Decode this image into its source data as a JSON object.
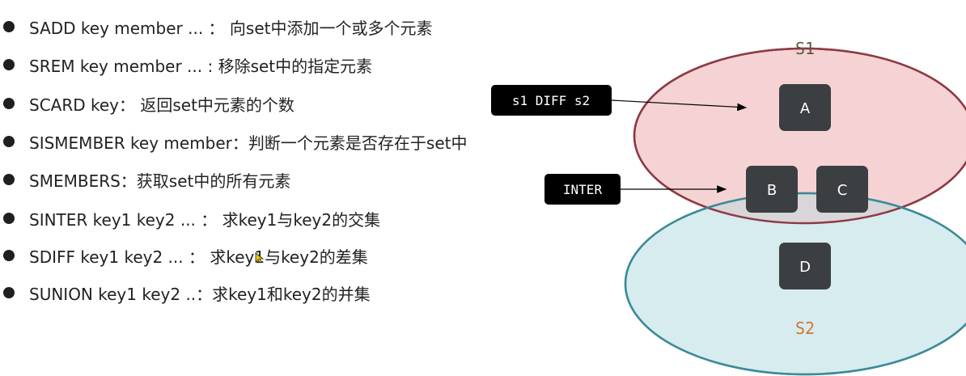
{
  "commands": [
    {
      "text": "SADD key member ... ： 向set中添加一个或多个元素"
    },
    {
      "text": "SREM key member ... : 移除set中的指定元素"
    },
    {
      "text": "SCARD key： 返回set中元素的个数"
    },
    {
      "text": "SISMEMBER key member：判断一个元素是否存在于set中"
    },
    {
      "text": "SMEMBERS：获取set中的所有元素"
    },
    {
      "text": "SINTER key1 key2 ... ： 求key1与key2的交集"
    },
    {
      "text": "SDIFF key1 key2 ... ： 求key1与key2的差集"
    },
    {
      "text": "SUNION key1 key2 ..：求key1和key2的并集"
    }
  ],
  "diagram": {
    "set1": {
      "label": "S1",
      "color": "#5a5a3a",
      "fill": "#f5d3d4",
      "stroke": "#8e3a44"
    },
    "set2": {
      "label": "S2",
      "color": "#d2772f",
      "fill": "#d6ecef",
      "stroke": "#3d8a98"
    },
    "intersection_fill": "#d8d6d8",
    "elements": {
      "a": "A",
      "b": "B",
      "c": "C",
      "d": "D"
    },
    "element_fill": "#3c3f41",
    "tags": {
      "diff": "s1 DIFF s2",
      "inter": "INTER"
    },
    "tag_fill": "#000000"
  }
}
